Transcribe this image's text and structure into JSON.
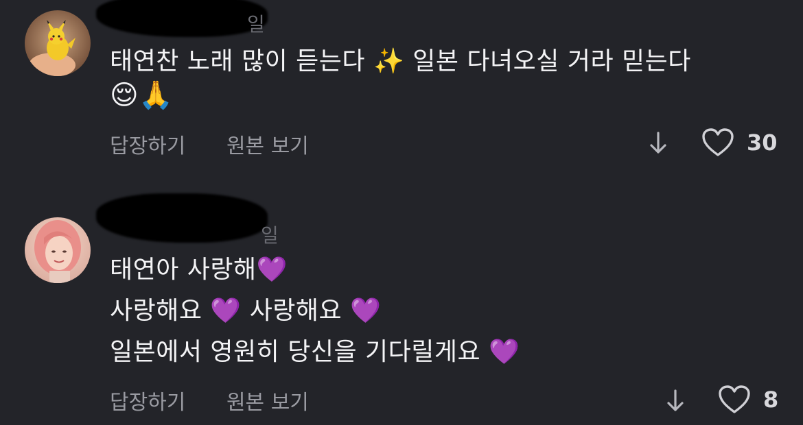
{
  "comments": [
    {
      "username_visible": "일",
      "avatar": "pikachu-figure-avatar",
      "lines": [
        "태연찬 노래 많이 듣는다 ✨ 일본 다녀오실 거라 믿는다",
        "😌🙏"
      ],
      "actions": {
        "reply": "답장하기",
        "original": "원본 보기"
      },
      "like_count": "30"
    },
    {
      "username_visible": "일",
      "avatar": "pink-hair-person-avatar",
      "lines": [
        "태연아 사랑해💜",
        "사랑해요 💜 사랑해요 💜",
        "일본에서 영원히 당신을 기다릴게요 💜"
      ],
      "actions": {
        "reply": "답장하기",
        "original": "원본 보기"
      },
      "like_count": "8"
    }
  ],
  "colors": {
    "background": "#232429",
    "text": "#f4f4f6",
    "muted": "#9a9ba2"
  }
}
